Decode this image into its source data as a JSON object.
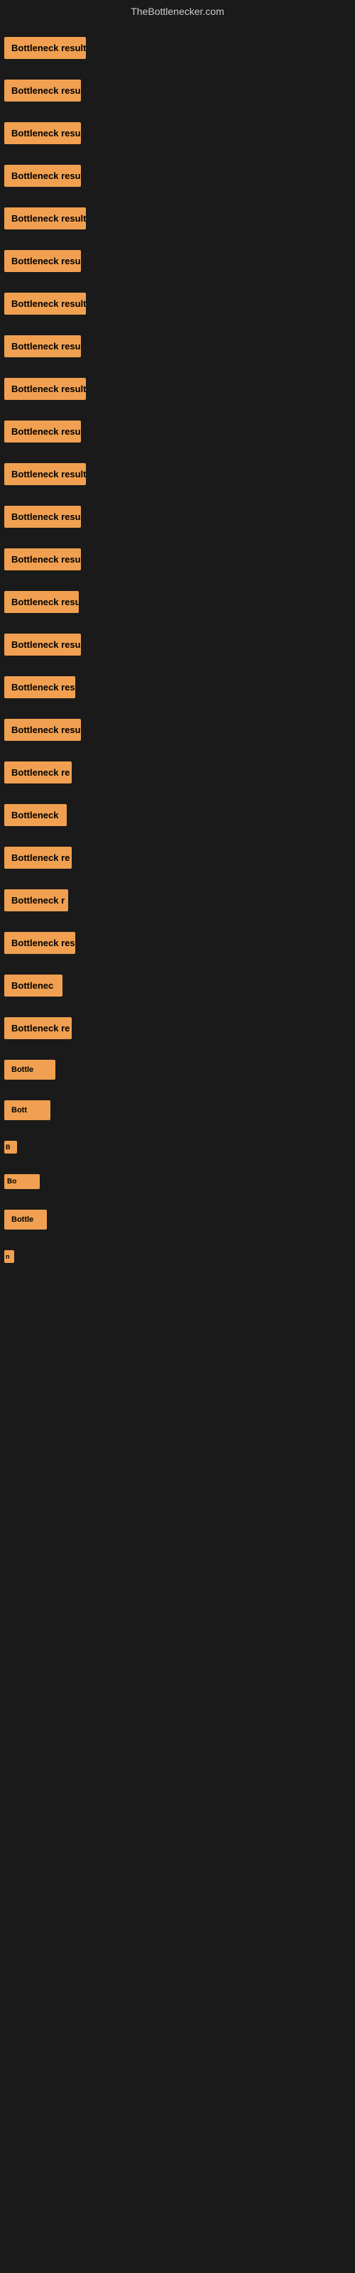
{
  "header": {
    "title": "TheBottlenecker.com"
  },
  "items": [
    {
      "label": "Bottleneck result",
      "width": 115
    },
    {
      "label": "Bottleneck result",
      "width": 108
    },
    {
      "label": "Bottleneck result",
      "width": 108
    },
    {
      "label": "Bottleneck result",
      "width": 108
    },
    {
      "label": "Bottleneck result",
      "width": 115
    },
    {
      "label": "Bottleneck result",
      "width": 108
    },
    {
      "label": "Bottleneck result",
      "width": 115
    },
    {
      "label": "Bottleneck result",
      "width": 108
    },
    {
      "label": "Bottleneck result",
      "width": 115
    },
    {
      "label": "Bottleneck result",
      "width": 108
    },
    {
      "label": "Bottleneck result",
      "width": 115
    },
    {
      "label": "Bottleneck result",
      "width": 108
    },
    {
      "label": "Bottleneck result",
      "width": 108
    },
    {
      "label": "Bottleneck result",
      "width": 105
    },
    {
      "label": "Bottleneck result",
      "width": 108
    },
    {
      "label": "Bottleneck res",
      "width": 100
    },
    {
      "label": "Bottleneck result",
      "width": 108
    },
    {
      "label": "Bottleneck re",
      "width": 95
    },
    {
      "label": "Bottleneck",
      "width": 88
    },
    {
      "label": "Bottleneck re",
      "width": 95
    },
    {
      "label": "Bottleneck r",
      "width": 90
    },
    {
      "label": "Bottleneck resu",
      "width": 100
    },
    {
      "label": "Bottlenec",
      "width": 82
    },
    {
      "label": "Bottleneck re",
      "width": 95
    },
    {
      "label": "Bottle",
      "width": 72
    },
    {
      "label": "Bott",
      "width": 65
    },
    {
      "label": "B",
      "width": 18
    },
    {
      "label": "Bo",
      "width": 50
    },
    {
      "label": "Bottle",
      "width": 60
    },
    {
      "label": "n",
      "width": 14
    }
  ],
  "colors": {
    "background": "#1a1a1a",
    "item_bg": "#f0a050",
    "header_text": "#cccccc"
  }
}
